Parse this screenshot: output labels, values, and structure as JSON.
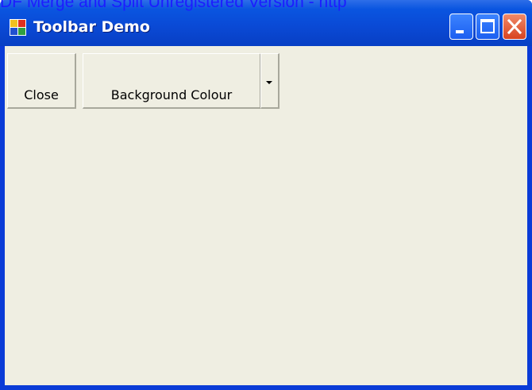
{
  "watermark": {
    "text": "DF Merge and Split Unregistered Version - http"
  },
  "window": {
    "title": "Toolbar Demo"
  },
  "caption_buttons": {
    "minimize_icon": "minimize-icon",
    "maximize_icon": "maximize-icon",
    "close_icon": "close-icon"
  },
  "toolbar": {
    "close_label": "Close",
    "background_label": "Background Colour",
    "dropdown_icon": "chevron-down-icon"
  },
  "colors": {
    "titlebar": "#0a4ad6",
    "client": "#efeee2",
    "watermark": "#1c1cff",
    "close_button": "#d8431f"
  }
}
